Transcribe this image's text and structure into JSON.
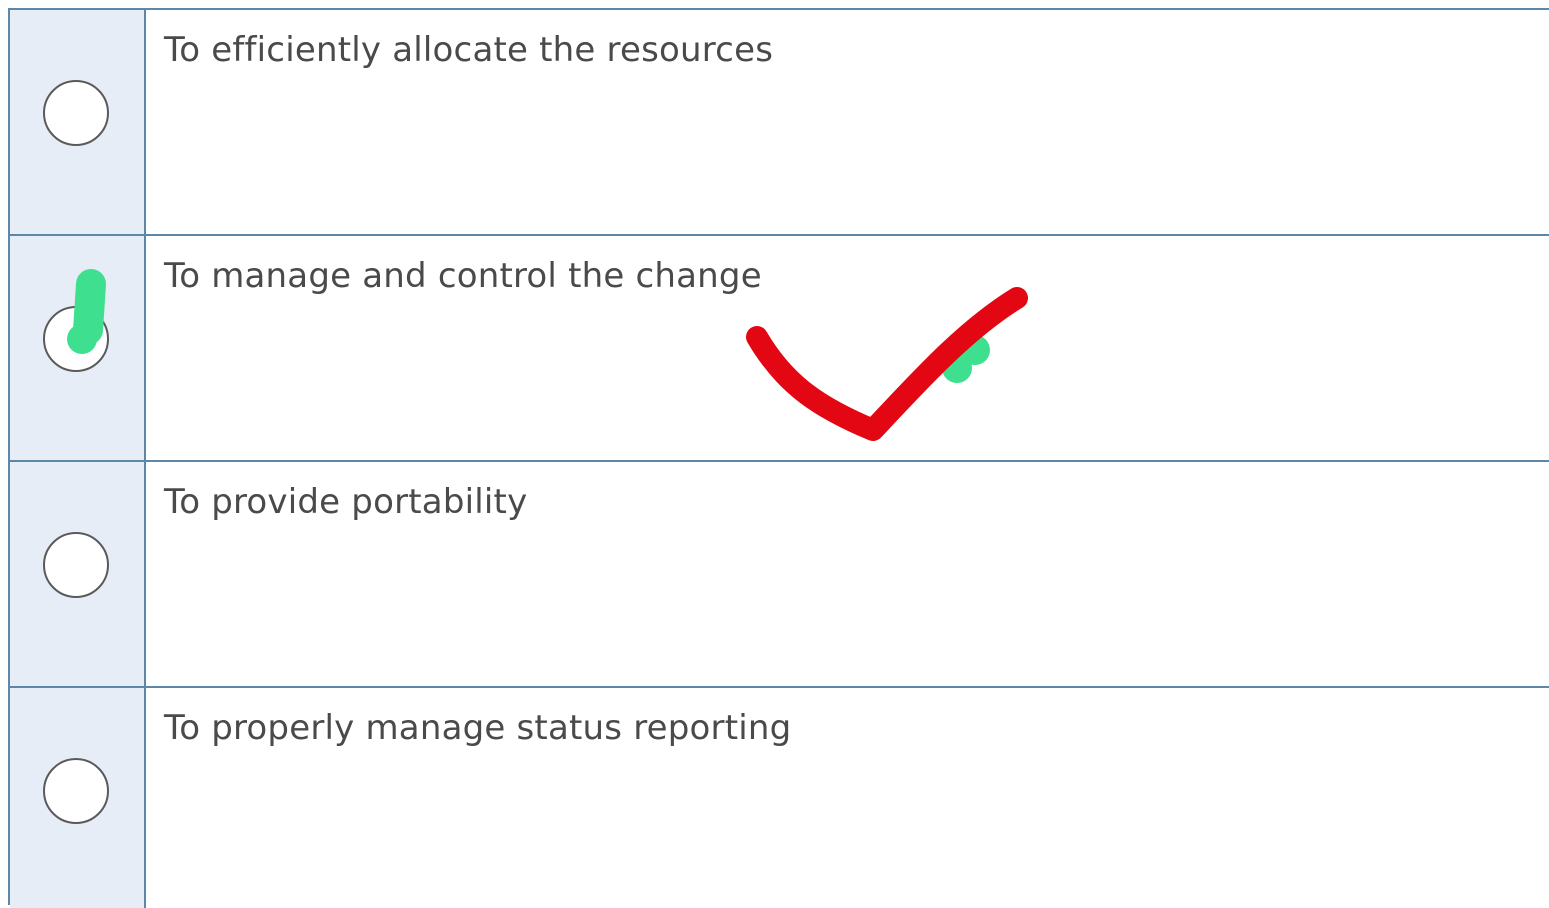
{
  "question": {
    "options": [
      {
        "label": "To efficiently allocate the resources",
        "selected": false
      },
      {
        "label": "To manage and control the change",
        "selected": true
      },
      {
        "label": "To provide portability",
        "selected": false
      },
      {
        "label": "To properly manage status reporting",
        "selected": false
      }
    ]
  },
  "annotations": {
    "checkmark_color": "#e30613",
    "highlighter_color": "#3ee08f"
  }
}
